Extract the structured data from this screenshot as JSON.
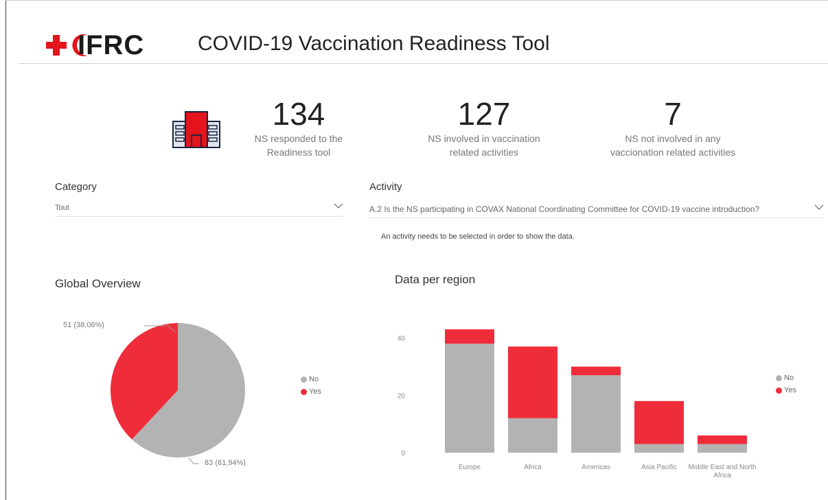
{
  "header": {
    "logo_text": "IFRC",
    "title": "COVID-19 Vaccination Readiness Tool"
  },
  "kpis": [
    {
      "value": "134",
      "label_line1": "NS responded to the",
      "label_line2": "Readiness tool"
    },
    {
      "value": "127",
      "label_line1": "NS involved in vaccination",
      "label_line2": "related activities"
    },
    {
      "value": "7",
      "label_line1": "NS not involved in any",
      "label_line2": "vaccionation related activities"
    }
  ],
  "filters": {
    "category": {
      "title": "Category",
      "value": "Tout"
    },
    "activity": {
      "title": "Activity",
      "value": "A.2 Is the NS participating in COVAX National Coordinating Committee for COVID-19 vaccine introduction?"
    },
    "note": "An activity needs to be selected in order to show the data."
  },
  "colors": {
    "no": "#b3b3b3",
    "yes": "#ef2d3a",
    "brand_red": "#e3141c"
  },
  "global_overview": {
    "title": "Global Overview",
    "label_yes": "51 (38,06%)",
    "label_no": "83 (61,94%)",
    "legend": [
      "No",
      "Yes"
    ]
  },
  "chart_data": {
    "type": "bar",
    "title": "Data per region",
    "categories": [
      "Europe",
      "Africa",
      "Americas",
      "Asia Pacific",
      "Middle East and North Africa"
    ],
    "series": [
      {
        "name": "No",
        "values": [
          38,
          12,
          27,
          3,
          3
        ]
      },
      {
        "name": "Yes",
        "values": [
          5,
          25,
          3,
          15,
          3
        ]
      }
    ],
    "stacked": true,
    "yticks": [
      0,
      20,
      40
    ],
    "ylim": [
      0,
      44
    ],
    "legend_position": "right",
    "grid": false
  }
}
